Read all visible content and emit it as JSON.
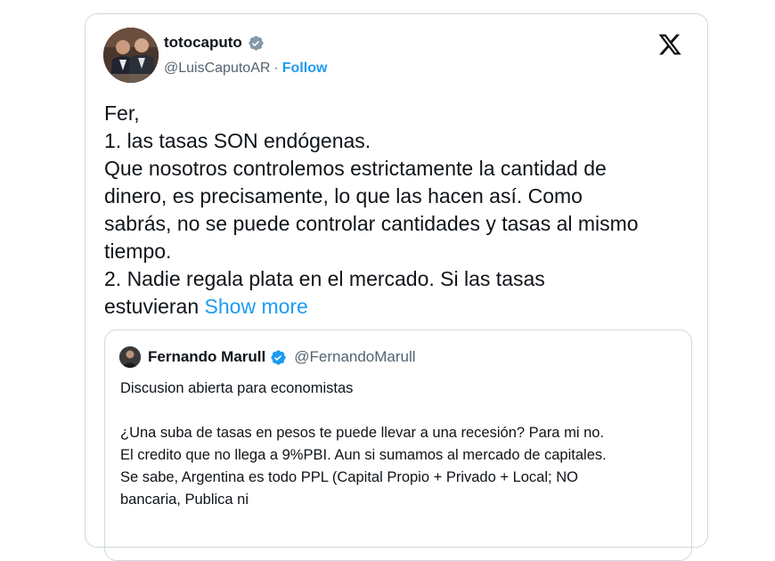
{
  "author": {
    "display_name": "totocaputo",
    "handle": "@LuisCaputoAR",
    "separator": "·",
    "follow_label": "Follow"
  },
  "tweet": {
    "lines": [
      "Fer,",
      "1. las tasas SON endógenas.",
      "Que nosotros controlemos estrictamente la cantidad de",
      "dinero, es precisamente, lo que las hacen así. Como",
      "sabrás, no se puede controlar cantidades y tasas al mismo",
      "tiempo.",
      "2. Nadie regala plata en el mercado. Si las tasas",
      "estuvieran"
    ],
    "show_more_label": "Show more"
  },
  "quoted_tweet": {
    "display_name": "Fernando Marull",
    "handle": "@FernandoMarull",
    "lines": [
      "Discusion abierta para economistas",
      "",
      "¿Una suba de tasas en pesos te puede llevar a una recesión? Para mi no.",
      "El credito que no llega a 9%PBI. Aun si sumamos al mercado de capitales.",
      "Se sabe, Argentina es todo PPL (Capital Propio + Privado + Local; NO",
      "bancaria, Publica ni"
    ]
  },
  "icons": {
    "verified_author": "verified-badge-gray",
    "verified_quoted": "verified-badge-blue",
    "logo": "x-logo"
  },
  "colors": {
    "link_blue": "#1d9bf0",
    "secondary_text": "#536471",
    "border": "#cfd9de",
    "verified_gray": "#829aab",
    "verified_blue": "#1d9bf0"
  }
}
